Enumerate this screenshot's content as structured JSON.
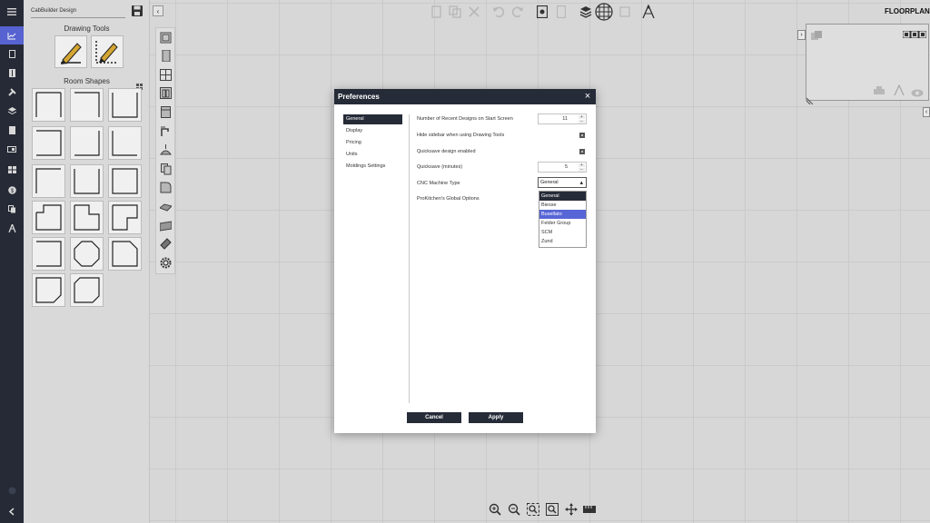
{
  "app": {
    "design_name": "CabBuilder Design",
    "view_label": "FLOORPLAN"
  },
  "sidebar": {
    "drawing_tools_title": "Drawing Tools",
    "room_shapes_title": "Room Shapes",
    "drawing_tools": [
      {
        "name": "draw-solid-wall-tool",
        "icon": "pencil-solid-icon"
      },
      {
        "name": "draw-dashed-wall-tool",
        "icon": "pencil-dashed-icon"
      }
    ]
  },
  "nav_rail": {
    "icons": [
      "menu-icon",
      "chart-icon",
      "document-icon",
      "cabinet-icon",
      "tools-icon",
      "layers-icon",
      "panel-icon",
      "monitor-icon",
      "grid-icon",
      "dollar-icon",
      "copy-icon",
      "compass-icon",
      "help-icon",
      "back-icon"
    ]
  },
  "dialog": {
    "title": "Preferences",
    "close_symbol": "×",
    "nav": [
      {
        "label": "General",
        "selected": true
      },
      {
        "label": "Display",
        "selected": false
      },
      {
        "label": "Pricing",
        "selected": false
      },
      {
        "label": "Units",
        "selected": false
      },
      {
        "label": "Moldings Settings",
        "selected": false
      }
    ],
    "settings": {
      "recent_designs_label": "Number of Recent Designs on Start Screen",
      "recent_designs_value": "11",
      "hide_sidebar_label": "Hide sidebar when using Drawing Tools",
      "quicksave_enabled_label": "Quicksave design enabled",
      "quicksave_minutes_label": "Quicksave (minutes)",
      "quicksave_minutes_value": "5",
      "cnc_label": "CNC Machine Type",
      "cnc_value": "General",
      "prokitchen_label": "ProKitchen's Global Options"
    },
    "cnc_options": [
      {
        "label": "General",
        "state": "current"
      },
      {
        "label": "Biesse",
        "state": "normal"
      },
      {
        "label": "Busellato",
        "state": "hover"
      },
      {
        "label": "Felder Group",
        "state": "normal"
      },
      {
        "label": "SCM",
        "state": "normal"
      },
      {
        "label": "Zund",
        "state": "normal"
      }
    ],
    "cancel_label": "Cancel",
    "apply_label": "Apply"
  },
  "colors": {
    "dark": "#262b38",
    "accent": "#5865d6",
    "pencil": "#d9a933"
  }
}
